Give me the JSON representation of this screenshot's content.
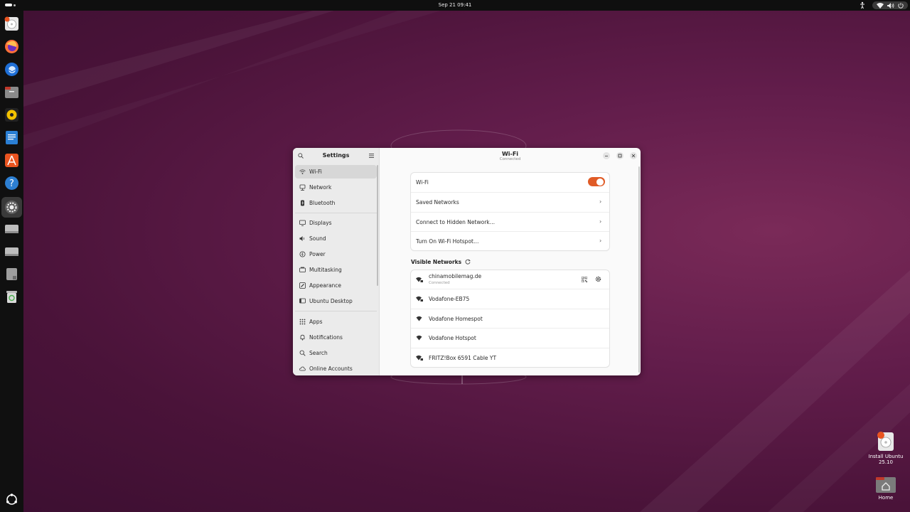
{
  "topbar": {
    "clock": "Sep 21  09:41"
  },
  "dock": {
    "apps": [
      "ubuntu-installer",
      "firefox",
      "thunderbird",
      "files",
      "rhythmbox",
      "libreoffice-writer",
      "app-center",
      "help",
      "settings",
      "drive-1",
      "drive-2",
      "usb-drive",
      "trash"
    ]
  },
  "desktop": {
    "install": {
      "line1": "Install Ubuntu",
      "line2": "25.10"
    },
    "home": {
      "label": "Home"
    }
  },
  "settings": {
    "sidebar": {
      "title": "Settings",
      "items": [
        {
          "label": "Wi-Fi",
          "icon": "wifi-icon"
        },
        {
          "label": "Network",
          "icon": "network-icon"
        },
        {
          "label": "Bluetooth",
          "icon": "bluetooth-icon"
        },
        {
          "label": "Displays",
          "icon": "display-icon"
        },
        {
          "label": "Sound",
          "icon": "sound-icon"
        },
        {
          "label": "Power",
          "icon": "power-icon"
        },
        {
          "label": "Multitasking",
          "icon": "multitasking-icon"
        },
        {
          "label": "Appearance",
          "icon": "appearance-icon"
        },
        {
          "label": "Ubuntu Desktop",
          "icon": "ubuntu-desktop-icon"
        },
        {
          "label": "Apps",
          "icon": "apps-icon"
        },
        {
          "label": "Notifications",
          "icon": "bell-icon"
        },
        {
          "label": "Search",
          "icon": "search-icon"
        },
        {
          "label": "Online Accounts",
          "icon": "cloud-icon"
        }
      ]
    },
    "header": {
      "title": "Wi-Fi",
      "subtitle": "Connected"
    },
    "controls": {
      "wifi_label": "Wi-Fi",
      "wifi_enabled": true,
      "saved_networks": "Saved Networks",
      "hidden_network": "Connect to Hidden Network…",
      "hotspot": "Turn On Wi-Fi Hotspot…"
    },
    "visible_networks": {
      "title": "Visible Networks",
      "list": [
        {
          "name": "chinamobilemag.de",
          "status": "Connected",
          "secured": true
        },
        {
          "name": "Vodafone-EB75",
          "secured": true
        },
        {
          "name": "Vodafone Homespot",
          "secured": false
        },
        {
          "name": "Vodafone Hotspot",
          "secured": false
        },
        {
          "name": "FRITZ!Box 6591 Cable YT",
          "secured": true
        }
      ]
    }
  },
  "colors": {
    "accent": "#e05b26",
    "wallpaper": "#621d4b",
    "dock": "#101010"
  }
}
